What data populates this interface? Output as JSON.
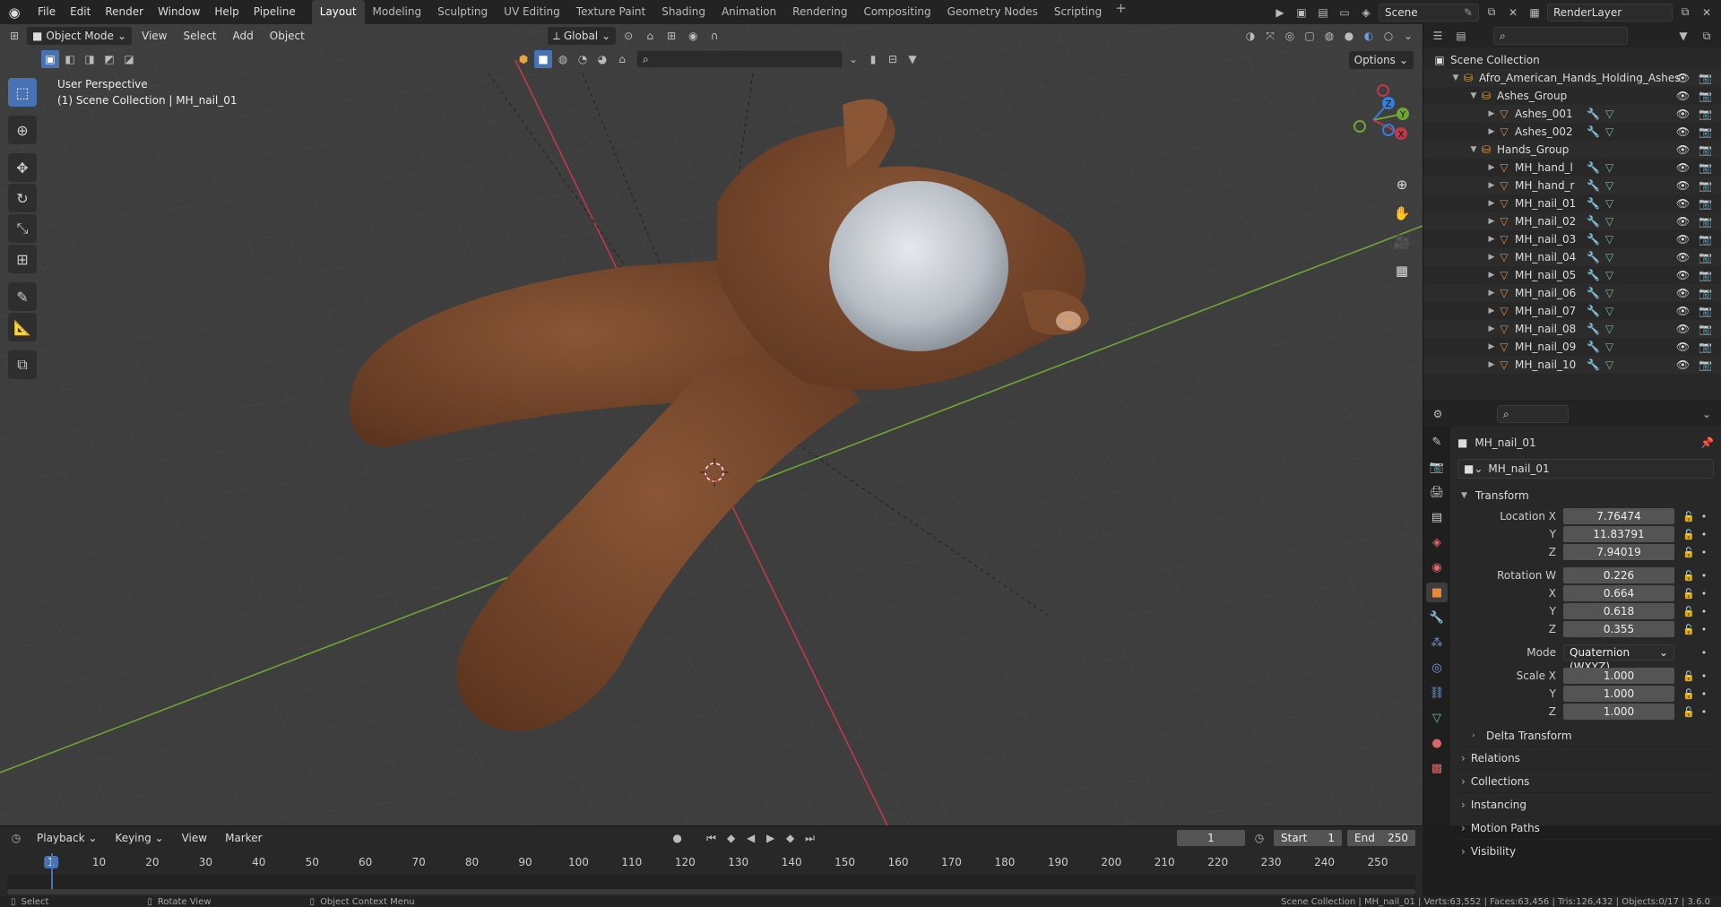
{
  "menu": {
    "items": [
      "File",
      "Edit",
      "Render",
      "Window",
      "Help",
      "Pipeline"
    ]
  },
  "workspaces": {
    "tabs": [
      "Layout",
      "Modeling",
      "Sculpting",
      "UV Editing",
      "Texture Paint",
      "Shading",
      "Animation",
      "Rendering",
      "Compositing",
      "Geometry Nodes",
      "Scripting"
    ],
    "active": "Layout"
  },
  "topright": {
    "scene": "Scene",
    "view_layer": "RenderLayer"
  },
  "viewport": {
    "mode": "Object Mode",
    "menus": [
      "View",
      "Select",
      "Add",
      "Object"
    ],
    "orientation": "Global",
    "options_label": "Options",
    "overlay_line1": "User Perspective",
    "overlay_line2": "(1) Scene Collection | MH_nail_01",
    "gizmo_axes": {
      "x": "X",
      "y": "Y",
      "z": "Z"
    }
  },
  "outliner": {
    "root": "Scene Collection",
    "items": [
      {
        "label": "Afro_American_Hands_Holding_Ashes",
        "indent": 1,
        "type": "collection"
      },
      {
        "label": "Ashes_Group",
        "indent": 2,
        "type": "collection"
      },
      {
        "label": "Ashes_001",
        "indent": 3,
        "type": "mesh"
      },
      {
        "label": "Ashes_002",
        "indent": 3,
        "type": "mesh"
      },
      {
        "label": "Hands_Group",
        "indent": 2,
        "type": "collection"
      },
      {
        "label": "MH_hand_l",
        "indent": 3,
        "type": "mesh"
      },
      {
        "label": "MH_hand_r",
        "indent": 3,
        "type": "mesh"
      },
      {
        "label": "MH_nail_01",
        "indent": 3,
        "type": "mesh"
      },
      {
        "label": "MH_nail_02",
        "indent": 3,
        "type": "mesh"
      },
      {
        "label": "MH_nail_03",
        "indent": 3,
        "type": "mesh"
      },
      {
        "label": "MH_nail_04",
        "indent": 3,
        "type": "mesh"
      },
      {
        "label": "MH_nail_05",
        "indent": 3,
        "type": "mesh"
      },
      {
        "label": "MH_nail_06",
        "indent": 3,
        "type": "mesh"
      },
      {
        "label": "MH_nail_07",
        "indent": 3,
        "type": "mesh"
      },
      {
        "label": "MH_nail_08",
        "indent": 3,
        "type": "mesh"
      },
      {
        "label": "MH_nail_09",
        "indent": 3,
        "type": "mesh"
      },
      {
        "label": "MH_nail_10",
        "indent": 3,
        "type": "mesh"
      }
    ]
  },
  "properties": {
    "object_name": "MH_nail_01",
    "data_name": "MH_nail_01",
    "transform_label": "Transform",
    "location": {
      "label": "Location X",
      "x": "7.76474",
      "y": "11.83791",
      "z": "7.94019"
    },
    "rotation": {
      "label": "Rotation W",
      "w": "0.226",
      "x": "0.664",
      "y": "0.618",
      "z": "0.355"
    },
    "mode": {
      "label": "Mode",
      "value": "Quaternion (WXYZ)"
    },
    "scale": {
      "label": "Scale X",
      "x": "1.000",
      "y": "1.000",
      "z": "1.000"
    },
    "axis_y": "Y",
    "axis_z": "Z",
    "axis_x": "X",
    "delta_transform": "Delta Transform",
    "panels": [
      "Relations",
      "Collections",
      "Instancing",
      "Motion Paths",
      "Visibility"
    ]
  },
  "timeline": {
    "menus": [
      "Playback",
      "Keying",
      "View",
      "Marker"
    ],
    "current_frame": "1",
    "start_label": "Start",
    "start": "1",
    "end_label": "End",
    "end": "250",
    "ticks": [
      "1",
      "10",
      "20",
      "30",
      "40",
      "50",
      "60",
      "70",
      "80",
      "90",
      "100",
      "110",
      "120",
      "130",
      "140",
      "150",
      "160",
      "170",
      "180",
      "190",
      "200",
      "210",
      "220",
      "230",
      "240",
      "250"
    ]
  },
  "status": {
    "select": "Select",
    "rotate": "Rotate View",
    "context": "Object Context Menu",
    "info": "Scene Collection | MH_nail_01 | Verts:63,552 | Faces:63,456 | Tris:126,432 | Objects:0/17 | 3.6.0"
  },
  "colors": {
    "accent": "#4772b3",
    "x_axis": "#c0394b",
    "y_axis": "#6ea534",
    "z_axis": "#2f7fe0",
    "skin": "#7a4a2c",
    "ashes": "#c8cdd3"
  }
}
